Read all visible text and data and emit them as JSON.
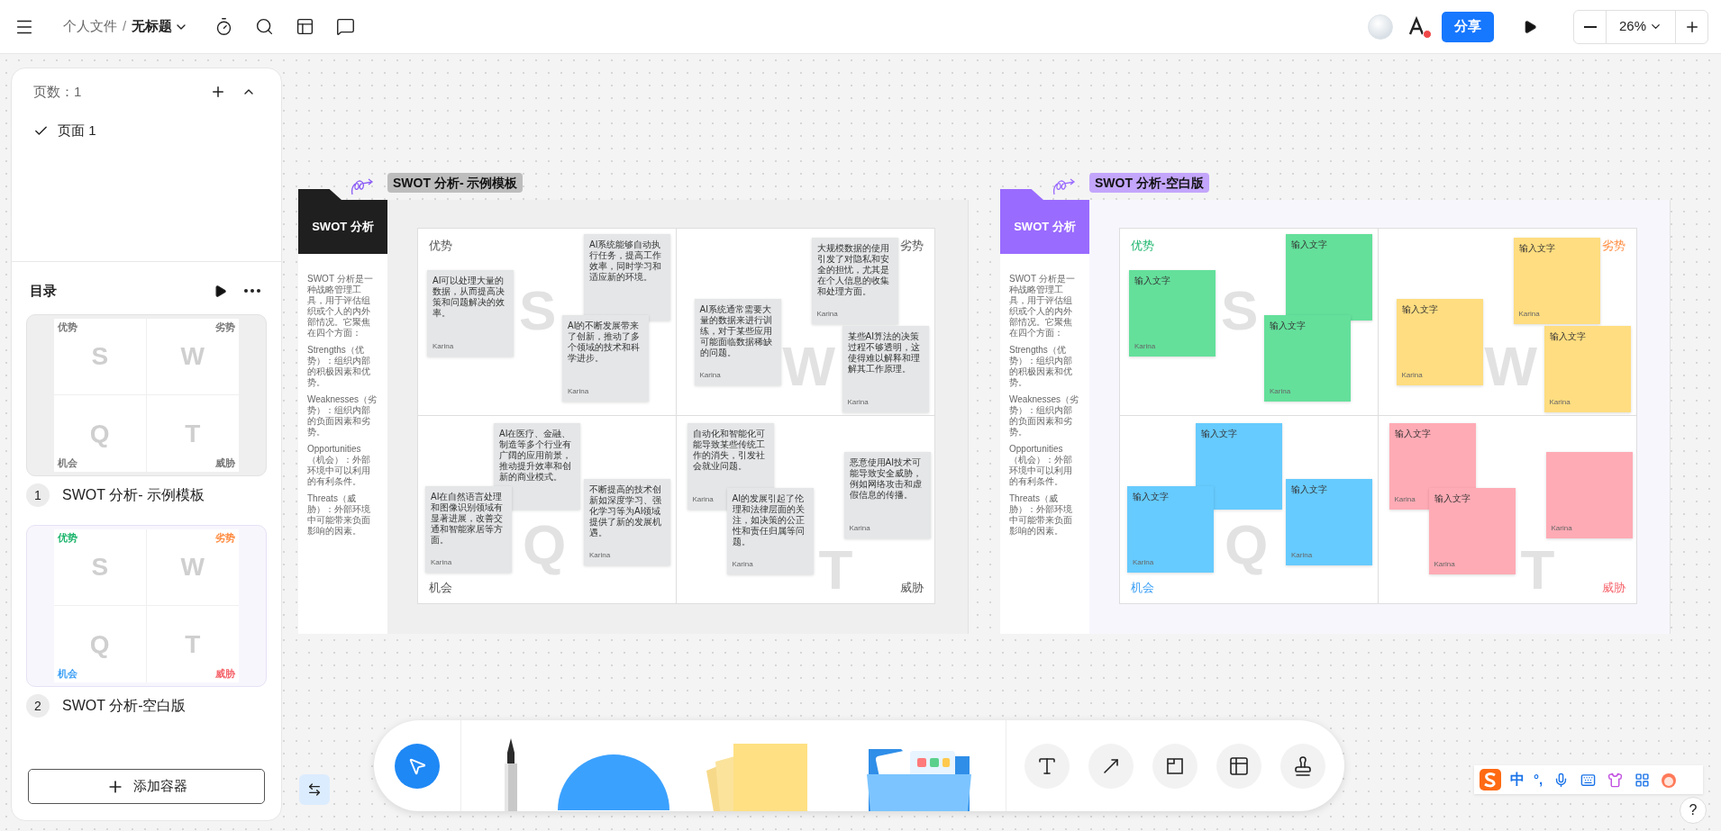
{
  "topbar": {
    "breadcrumb": "个人文件",
    "separator": "/",
    "title": "无标题",
    "share": "分享",
    "zoom": "26%"
  },
  "pages_panel": {
    "count_label": "页数：1",
    "pages": [
      {
        "label": "页面 1",
        "selected": true
      }
    ]
  },
  "outline": {
    "title": "目录",
    "add_button": "添加容器",
    "items": [
      {
        "number": "1",
        "title": "SWOT 分析- 示例模板",
        "kind": "example",
        "thumbnail": [
          {
            "label": "优势",
            "letter": "S",
            "color": "#777777"
          },
          {
            "label": "劣势",
            "letter": "W",
            "color": "#777777"
          },
          {
            "label": "机会",
            "letter": "Q",
            "color": "#777777"
          },
          {
            "label": "威胁",
            "letter": "T",
            "color": "#777777"
          }
        ]
      },
      {
        "number": "2",
        "title": "SWOT 分析-空白版",
        "kind": "blank",
        "thumbnail": [
          {
            "label": "优势",
            "letter": "S",
            "color": "#19b46a"
          },
          {
            "label": "劣势",
            "letter": "W",
            "color": "#ff8a3d"
          },
          {
            "label": "机会",
            "letter": "Q",
            "color": "#3a9ff5"
          },
          {
            "label": "威胁",
            "letter": "T",
            "color": "#f5646b"
          }
        ]
      }
    ]
  },
  "boards": [
    {
      "kind": "example",
      "title": "SWOT 分析- 示例模板",
      "header": "SWOT 分析",
      "description": [
        "SWOT 分析是一种战略管理工具，用于评估组织或个人的内外部情况。它聚焦在四个方面：",
        "Strengths（优势）：组织内部的积极因素和优势。",
        "Weaknesses（劣势）：组织内部的负面因素和劣势。",
        "Opportunities（机会）：外部环境中可以利用的有利条件。",
        "Threats（威胁）：外部环境中可能带来负面影响的因素。"
      ],
      "quadrants": [
        {
          "label": "优势",
          "letter": "S",
          "color": "#555555",
          "notes": [
            {
              "text": "AI可以处理大量的数据，从而提高决策和问题解决的效率。",
              "author": "Karina",
              "color": "#e4e6e7"
            },
            {
              "text": "AI系统能够自动执行任务，提高工作效率，同时学习和适应新的环境。",
              "color": "#e4e6e7"
            },
            {
              "text": "AI的不断发展带来了创新，推动了多个领域的技术和科学进步。",
              "author": "Karina",
              "color": "#e4e6e7"
            }
          ]
        },
        {
          "label": "劣势",
          "letter": "W",
          "color": "#555555",
          "notes": [
            {
              "text": "AI系统通常需要大量的数据来进行训练，对于某些应用可能面临数据稀缺的问题。",
              "author": "Karina",
              "color": "#e4e6e7"
            },
            {
              "text": "大规模数据的使用引发了对隐私和安全的担忧，尤其是在个人信息的收集和处理方面。",
              "author": "Karina",
              "color": "#e4e6e7"
            },
            {
              "text": "某些AI算法的决策过程不够透明，这使得难以解释和理解其工作原理。",
              "author": "Karina",
              "color": "#e4e6e7"
            }
          ]
        },
        {
          "label": "机会",
          "letter": "Q",
          "color": "#555555",
          "notes": [
            {
              "text": "AI在医疗、金融、制造等多个行业有广阔的应用前景，推动提升效率和创新的商业模式。",
              "color": "#e4e6e7"
            },
            {
              "text": "AI在自然语言处理和图像识别领域有显著进展，改善交通和智能家居等方面。",
              "author": "Karina",
              "color": "#e4e6e7"
            },
            {
              "text": "不断提高的技术创新如深度学习、强化学习等为AI领域提供了新的发展机遇。",
              "author": "Karina",
              "color": "#e4e6e7"
            }
          ]
        },
        {
          "label": "威胁",
          "letter": "T",
          "color": "#555555",
          "notes": [
            {
              "text": "自动化和智能化可能导致某些传统工作的消失，引发社会就业问题。",
              "author": "Karina",
              "color": "#e4e6e7"
            },
            {
              "text": "AI的发展引起了伦理和法律层面的关注，如决策的公正性和责任归属等问题。",
              "author": "Karina",
              "color": "#e4e6e7"
            },
            {
              "text": "恶意使用AI技术可能导致安全威胁，例如网络攻击和虚假信息的传播。",
              "author": "Karina",
              "color": "#e4e6e7"
            }
          ]
        }
      ]
    },
    {
      "kind": "blank",
      "title": "SWOT 分析-空白版",
      "header": "SWOT 分析",
      "description": [
        "SWOT 分析是一种战略管理工具，用于评估组织或个人的内外部情况。它聚焦在四个方面：",
        "Strengths（优势）：组织内部的积极因素和优势。",
        "Weaknesses（劣势）：组织内部的负面因素和劣势。",
        "Opportunities（机会）：外部环境中可以利用的有利条件。",
        "Threats（威胁）：外部环境中可能带来负面影响的因素。"
      ],
      "quadrants": [
        {
          "label": "优势",
          "letter": "S",
          "color": "#19b46a",
          "notes": [
            {
              "text": "输入文字",
              "author": "Karina",
              "color": "#64e09b"
            },
            {
              "text": "输入文字",
              "color": "#64e09b"
            },
            {
              "text": "输入文字",
              "author": "Karina",
              "color": "#64e09b"
            }
          ]
        },
        {
          "label": "劣势",
          "letter": "W",
          "color": "#ff8a3d",
          "notes": [
            {
              "text": "输入文字",
              "author": "Karina",
              "color": "#ffdd80"
            },
            {
              "text": "输入文字",
              "author": "Karina",
              "color": "#ffdd80"
            },
            {
              "text": "输入文字",
              "author": "Karina",
              "color": "#ffdd80"
            }
          ]
        },
        {
          "label": "机会",
          "letter": "Q",
          "color": "#3a9ff5",
          "notes": [
            {
              "text": "输入文字",
              "color": "#66cbfe"
            },
            {
              "text": "输入文字",
              "author": "Karina",
              "color": "#66cbfe"
            },
            {
              "text": "输入文字",
              "author": "Karina",
              "color": "#66cbfe"
            }
          ]
        },
        {
          "label": "威胁",
          "letter": "T",
          "color": "#f5646b",
          "notes": [
            {
              "text": "输入文字",
              "author": "Karina",
              "color": "#ffabb5"
            },
            {
              "text": "输入文字",
              "author": "Karina",
              "color": "#ffabb5"
            },
            {
              "author": "Karina",
              "color": "#ffabb5"
            }
          ]
        }
      ]
    }
  ],
  "ime_bar": {
    "mode": "中",
    "punctuation": "°,"
  },
  "help": "?"
}
